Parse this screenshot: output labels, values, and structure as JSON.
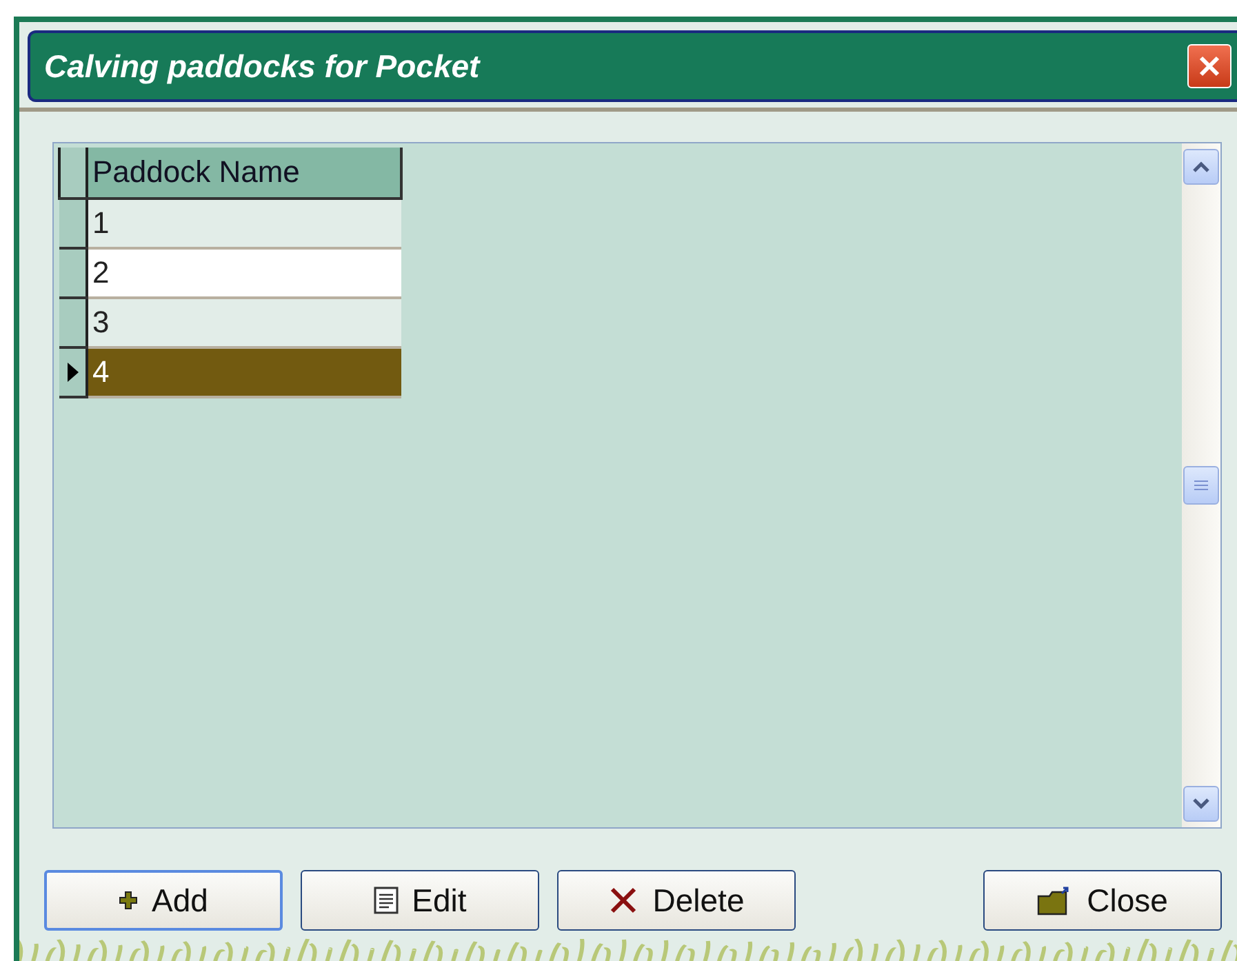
{
  "window": {
    "title": "Calving paddocks for Pocket"
  },
  "table": {
    "columns": [
      "Paddock Name"
    ],
    "rows": [
      {
        "cells": [
          "1"
        ],
        "selected": false
      },
      {
        "cells": [
          "2"
        ],
        "selected": false
      },
      {
        "cells": [
          "3"
        ],
        "selected": false
      },
      {
        "cells": [
          "4"
        ],
        "selected": true
      }
    ]
  },
  "buttons": [
    {
      "label": "Add",
      "kind": "add"
    },
    {
      "label": "Edit",
      "kind": "edit"
    },
    {
      "label": "Delete",
      "kind": "delete"
    },
    {
      "label": "Close",
      "kind": "close"
    }
  ]
}
